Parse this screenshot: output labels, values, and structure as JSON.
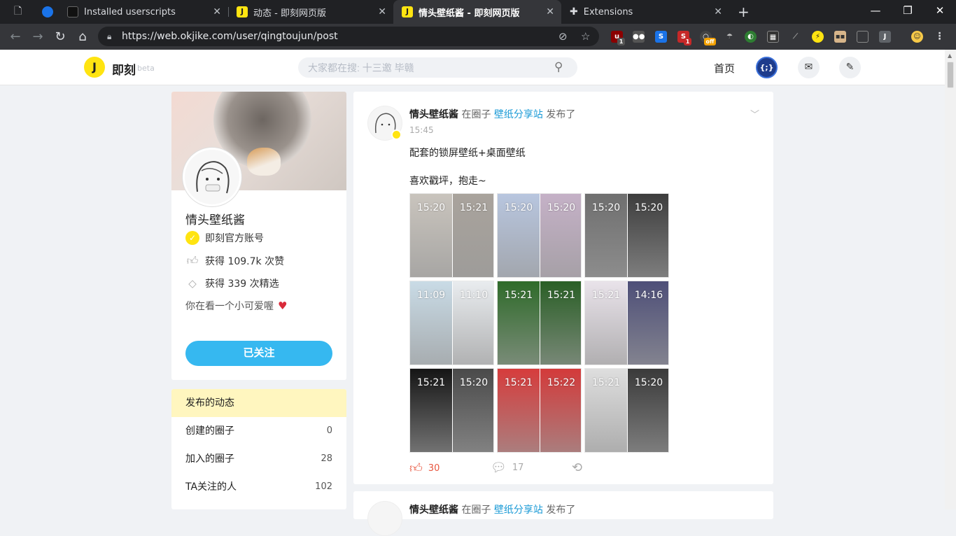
{
  "browser": {
    "tabs": [
      {
        "title": "",
        "icon": "document-icon"
      },
      {
        "title": "",
        "icon": "app-icon"
      },
      {
        "title": "Installed userscripts",
        "icon": "tampermonkey-icon"
      },
      {
        "title": "动态 - 即刻网页版",
        "icon": "jike-icon"
      },
      {
        "title": "情头壁纸酱 - 即刻网页版",
        "icon": "jike-icon",
        "active": true
      },
      {
        "title": "Extensions",
        "icon": "puzzle-icon"
      }
    ],
    "url": "https://web.okjike.com/user/qingtoujun/post",
    "ext_badges": [
      "1",
      "1",
      "off"
    ]
  },
  "site": {
    "brand": "即刻",
    "beta": "beta",
    "logo": "J",
    "search_placeholder": "大家都在搜: 十三邀 毕赣",
    "home": "首页",
    "user_avatar": "{;}"
  },
  "profile": {
    "name": "情头壁纸酱",
    "official": "即刻官方账号",
    "likes": "获得 109.7k 次赞",
    "featured": "获得 339 次精选",
    "bio": "你在看一个小可爱喔",
    "follow": "已关注"
  },
  "menu": [
    {
      "label": "发布的动态",
      "count": "",
      "active": true
    },
    {
      "label": "创建的圈子",
      "count": "0"
    },
    {
      "label": "加入的圈子",
      "count": "28"
    },
    {
      "label": "TA关注的人",
      "count": "102"
    }
  ],
  "post": {
    "author": "情头壁纸酱",
    "in_topic": "在圈子",
    "topic": "壁纸分享站",
    "published": "发布了",
    "time": "15:45",
    "line1": "配套的锁屏壁纸+桌面壁纸",
    "line2": "喜欢戳坪，抱走~",
    "likes": "30",
    "comments": "17",
    "images": [
      {
        "t1": "15:20",
        "t2": "15:21",
        "c1": "#c9c4bd",
        "c2": "#a9a39c"
      },
      {
        "t1": "15:20",
        "t2": "15:20",
        "c1": "#b8c6df",
        "c2": "#c5b1c7"
      },
      {
        "t1": "15:20",
        "t2": "15:20",
        "c1": "#6f6f6f",
        "c2": "#3d3d3d"
      },
      {
        "t1": "11:09",
        "t2": "11:10",
        "c1": "#c9dbe6",
        "c2": "#e9ecef"
      },
      {
        "t1": "15:21",
        "t2": "15:21",
        "c1": "#2f6b2a",
        "c2": "#2a5f26"
      },
      {
        "t1": "15:21",
        "t2": "14:16",
        "c1": "#e9e3ea",
        "c2": "#4e4f78"
      },
      {
        "t1": "15:21",
        "t2": "15:20",
        "c1": "#151515",
        "c2": "#4a4a4a"
      },
      {
        "t1": "15:21",
        "t2": "15:22",
        "c1": "#d63c3c",
        "c2": "#d33a3a"
      },
      {
        "t1": "15:21",
        "t2": "15:20",
        "c1": "#dedede",
        "c2": "#3a3a3a"
      }
    ]
  },
  "post2": {
    "author": "情头壁纸酱",
    "in_topic": "在圈子",
    "topic": "壁纸分享站",
    "published": "发布了"
  }
}
